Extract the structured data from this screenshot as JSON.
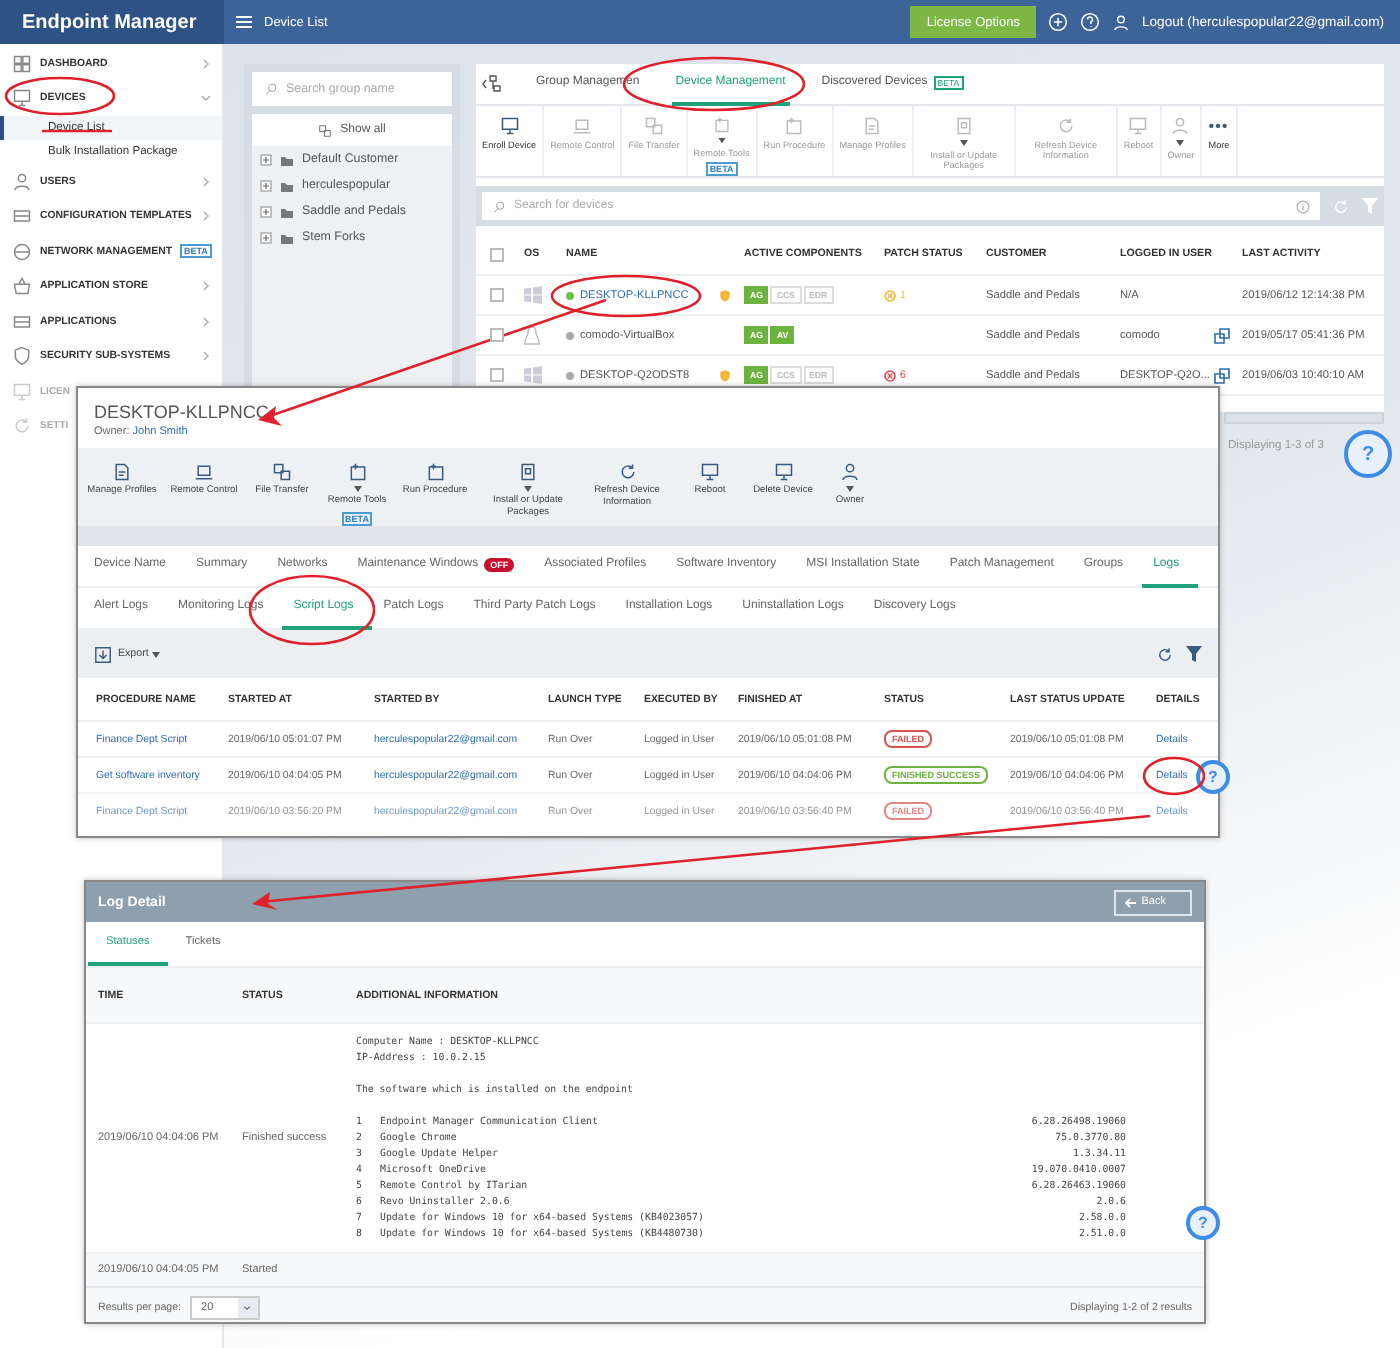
{
  "app": {
    "title": "Endpoint Manager",
    "page_title": "Device List",
    "license_button": "License Options",
    "logout": "Logout (herculespopular22@gmail.com)"
  },
  "sidebar": {
    "items": [
      {
        "label": "DASHBOARD",
        "expanded": false
      },
      {
        "label": "DEVICES",
        "expanded": true,
        "children": [
          {
            "label": "Device List",
            "selected": true
          },
          {
            "label": "Bulk Installation Package",
            "selected": false
          }
        ]
      },
      {
        "label": "USERS",
        "expanded": false
      },
      {
        "label": "CONFIGURATION TEMPLATES",
        "expanded": false
      },
      {
        "label": "NETWORK MANAGEMENT",
        "badge": "BETA",
        "expanded": false
      },
      {
        "label": "APPLICATION STORE",
        "expanded": false
      },
      {
        "label": "APPLICATIONS",
        "expanded": false
      },
      {
        "label": "SECURITY SUB-SYSTEMS",
        "expanded": false
      },
      {
        "label": "LICEN"
      },
      {
        "label": "SETTI"
      }
    ]
  },
  "groups": {
    "search_placeholder": "Search group name",
    "show_all": "Show all",
    "items": [
      {
        "label": "Default Customer",
        "expanded": false
      },
      {
        "label": "herculespopular",
        "expanded": false
      },
      {
        "label": "Saddle and Pedals",
        "expanded": false
      },
      {
        "label": "Stem Forks",
        "expanded": false
      }
    ]
  },
  "devices_panel": {
    "tabs": [
      {
        "label": "Group Managemen",
        "selected": false
      },
      {
        "label": "Device Management",
        "selected": true
      },
      {
        "label": "Discovered Devices",
        "badge": "BETA",
        "selected": false
      }
    ],
    "toolbar": [
      {
        "label": "Enroll Device",
        "disabled": false
      },
      {
        "label": "Remote Control",
        "disabled": true
      },
      {
        "label": "File Transfer",
        "disabled": true
      },
      {
        "label": "Remote Tools",
        "badge": "BETA",
        "menu": true,
        "disabled": true
      },
      {
        "label": "Run Procedure",
        "disabled": true
      },
      {
        "label": "Manage Profiles",
        "disabled": true
      },
      {
        "label": "Install or Update Packages",
        "menu": true,
        "disabled": true
      },
      {
        "label": "Refresh Device Information",
        "disabled": true
      },
      {
        "label": "Reboot",
        "disabled": true
      },
      {
        "label": "Owner",
        "menu": true,
        "disabled": true
      },
      {
        "label": "More",
        "disabled": false
      }
    ],
    "search_placeholder": "Search for devices",
    "all_checked": false,
    "columns": [
      "OS",
      "NAME",
      "ACTIVE COMPONENTS",
      "PATCH STATUS",
      "CUSTOMER",
      "LOGGED IN USER",
      "LAST ACTIVITY"
    ],
    "rows": [
      {
        "kind": "windows",
        "checked": false,
        "online": true,
        "name": "DESKTOP-KLLPNCC",
        "shield": true,
        "components": [
          {
            "label": "AG",
            "on": true
          },
          {
            "label": "CCS",
            "on": false
          },
          {
            "label": "EDR",
            "on": false
          }
        ],
        "patch": {
          "kind": "warning",
          "count": "1"
        },
        "customer": "Saddle and Pedals",
        "user": "N/A",
        "remote": false,
        "last_activity": "2019/06/12 12:14:38 PM"
      },
      {
        "kind": "linux",
        "checked": false,
        "online": false,
        "name": "comodo-VirtualBox",
        "shield": false,
        "components": [
          {
            "label": "AG",
            "on": true
          },
          {
            "label": "AV",
            "on": true
          }
        ],
        "customer": "Saddle and Pedals",
        "user": "comodo",
        "remote": true,
        "last_activity": "2019/05/17 05:41:36 PM"
      },
      {
        "kind": "windows",
        "checked": false,
        "online": false,
        "name": "DESKTOP-Q2ODST8",
        "shield": true,
        "components": [
          {
            "label": "AG",
            "on": true
          },
          {
            "label": "CCS",
            "on": false
          },
          {
            "label": "EDR",
            "on": false
          }
        ],
        "patch": {
          "kind": "error",
          "count": "6"
        },
        "customer": "Saddle and Pedals",
        "user": "DESKTOP-Q2O...",
        "remote": true,
        "last_activity": "2019/06/03 10:40:10 AM"
      }
    ],
    "footer": "Displaying 1-3 of 3"
  },
  "device_window": {
    "title": "DESKTOP-KLLPNCC",
    "owner_label": "Owner:",
    "owner": "John Smith",
    "toolbar": [
      {
        "label": "Manage Profiles"
      },
      {
        "label": "Remote Control"
      },
      {
        "label": "File Transfer"
      },
      {
        "label": "Remote Tools",
        "badge": "BETA",
        "menu": true
      },
      {
        "label": "Run Procedure"
      },
      {
        "label": "Install or Update Packages",
        "menu": true
      },
      {
        "label": "Refresh Device Information"
      },
      {
        "label": "Reboot"
      },
      {
        "label": "Delete Device"
      },
      {
        "label": "Owner",
        "menu": true
      }
    ],
    "tabs": [
      {
        "label": "Device Name",
        "selected": false
      },
      {
        "label": "Summary",
        "selected": false
      },
      {
        "label": "Networks",
        "selected": false
      },
      {
        "label": "Maintenance Windows",
        "badge": "OFF",
        "selected": false
      },
      {
        "label": "Associated Profiles",
        "selected": false
      },
      {
        "label": "Software Inventory",
        "selected": false
      },
      {
        "label": "MSI Installation State",
        "selected": false
      },
      {
        "label": "Patch Management",
        "selected": false
      },
      {
        "label": "Groups",
        "selected": false
      },
      {
        "label": "Logs",
        "selected": true
      }
    ],
    "subtabs": [
      {
        "label": "Alert Logs",
        "selected": false
      },
      {
        "label": "Monitoring Logs",
        "selected": false
      },
      {
        "label": "Script Logs",
        "selected": true
      },
      {
        "label": "Patch Logs",
        "selected": false
      },
      {
        "label": "Third Party Patch Logs",
        "selected": false
      },
      {
        "label": "Installation Logs",
        "selected": false
      },
      {
        "label": "Uninstallation Logs",
        "selected": false
      },
      {
        "label": "Discovery Logs",
        "selected": false
      }
    ],
    "export": "Export",
    "columns": [
      "PROCEDURE NAME",
      "STARTED AT",
      "STARTED BY",
      "LAUNCH TYPE",
      "EXECUTED BY",
      "FINISHED AT",
      "STATUS",
      "LAST STATUS UPDATE",
      "DETAILS"
    ],
    "rows": [
      {
        "procedure": "Finance Dept Script",
        "started_at": "2019/06/10 05:01:07 PM",
        "started_by": "herculespopular22@gmail.com",
        "launch_type": "Run Over",
        "executed_by": "Logged in User",
        "finished_at": "2019/06/10 05:01:08 PM",
        "status": {
          "label": "FAILED",
          "kind": "failed"
        },
        "last_update": "2019/06/10 05:01:08 PM",
        "details": "Details",
        "dimmed": false
      },
      {
        "procedure": "Get software inventory",
        "started_at": "2019/06/10 04:04:05 PM",
        "started_by": "herculespopular22@gmail.com",
        "launch_type": "Run Over",
        "executed_by": "Logged in User",
        "finished_at": "2019/06/10 04:04:06 PM",
        "status": {
          "label": "FINISHED SUCCESS",
          "kind": "success"
        },
        "last_update": "2019/06/10 04:04:06 PM",
        "details": "Details",
        "dimmed": false
      },
      {
        "procedure": "Finance Dept Script",
        "started_at": "2019/06/10 03:56:20 PM",
        "started_by": "herculespopular22@gmail.com",
        "launch_type": "Run Over",
        "executed_by": "Logged in User",
        "finished_at": "2019/06/10 03:56:40 PM",
        "status": {
          "label": "FAILED",
          "kind": "failed"
        },
        "last_update": "2019/06/10 03:56:40 PM",
        "details": "Details",
        "dimmed": true
      }
    ]
  },
  "log_window": {
    "title": "Log Detail",
    "back": "Back",
    "tabs": [
      {
        "label": "Statuses",
        "selected": true
      },
      {
        "label": "Tickets",
        "selected": false
      }
    ],
    "columns": [
      "TIME",
      "STATUS",
      "ADDITIONAL INFORMATION"
    ],
    "rows": [
      {
        "time": "2019/06/10 04:04:06 PM",
        "status": "Finished success",
        "info": {
          "lines": [
            "Computer Name : DESKTOP-KLLPNCC",
            "IP-Address : 10.0.2.15"
          ],
          "intro": "The software which is installed on the endpoint",
          "software": [
            {
              "index": "1",
              "name": "Endpoint Manager Communication Client",
              "version": "6.28.26498.19060"
            },
            {
              "index": "2",
              "name": "Google Chrome",
              "version": "75.0.3770.80"
            },
            {
              "index": "3",
              "name": "Google Update Helper",
              "version": "1.3.34.11"
            },
            {
              "index": "4",
              "name": "Microsoft OneDrive",
              "version": "19.070.0410.0007"
            },
            {
              "index": "5",
              "name": "Remote Control by ITarian",
              "version": "6.28.26463.19060"
            },
            {
              "index": "6",
              "name": "Revo Uninstaller 2.0.6",
              "version": "2.0.6"
            },
            {
              "index": "7",
              "name": "Update for Windows 10 for x64-based Systems (KB4023057)",
              "version": "2.58.0.0"
            },
            {
              "index": "8",
              "name": "Update for Windows 10 for x64-based Systems (KB4480730)",
              "version": "2.51.0.0"
            }
          ]
        }
      },
      {
        "time": "2019/06/10 04:04:05 PM",
        "status": "Started"
      }
    ],
    "results_label": "Results per page:",
    "per_page": "20",
    "summary": "Displaying 1-2 of 2 results"
  },
  "help_buttons": [
    {
      "label": "?"
    },
    {
      "label": "?"
    },
    {
      "label": "?"
    }
  ]
}
